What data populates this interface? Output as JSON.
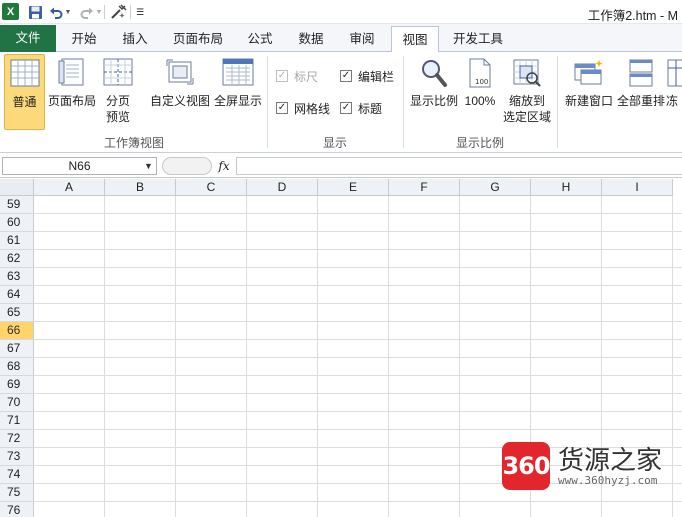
{
  "app": {
    "logo_letter": "X",
    "document_title": "工作簿2.htm - M"
  },
  "quick_access": {
    "save_icon": "save-icon",
    "undo_icon": "undo-icon",
    "redo_icon": "redo-icon",
    "tool_icon": "tools-icon",
    "customize_icon": "customize-icon"
  },
  "tabs": [
    {
      "label": "文件"
    },
    {
      "label": "开始"
    },
    {
      "label": "插入"
    },
    {
      "label": "页面布局"
    },
    {
      "label": "公式"
    },
    {
      "label": "数据"
    },
    {
      "label": "审阅"
    },
    {
      "label": "视图"
    },
    {
      "label": "开发工具"
    }
  ],
  "active_tab": "视图",
  "ribbon": {
    "workbook_views": {
      "label": "工作簿视图",
      "normal": "普通",
      "page_layout": "页面布局",
      "page_break_line1": "分页",
      "page_break_line2": "预览",
      "custom_views": "自定义视图",
      "full_screen": "全屏显示"
    },
    "show": {
      "label": "显示",
      "ruler": "标尺",
      "formula_bar": "编辑栏",
      "gridlines": "网格线",
      "headings": "标题"
    },
    "zoom": {
      "label": "显示比例",
      "zoom_btn": "显示比例",
      "hundred": "100%",
      "zoom_sel_line1": "缩放到",
      "zoom_sel_line2": "选定区域"
    },
    "window": {
      "new_window": "新建窗口",
      "arrange_all": "全部重排",
      "freeze_partial": "冻"
    }
  },
  "formula_bar": {
    "name_box": "N66",
    "fx": "fx",
    "formula": ""
  },
  "columns": [
    "A",
    "B",
    "C",
    "D",
    "E",
    "F",
    "G",
    "H",
    "I"
  ],
  "rows": [
    "59",
    "60",
    "61",
    "62",
    "63",
    "64",
    "65",
    "66",
    "67",
    "68",
    "69",
    "70",
    "71",
    "72",
    "73",
    "74",
    "75",
    "76"
  ],
  "selected_row": "66",
  "watermark": {
    "logo_text": "360",
    "title": "货源之家",
    "url": "www.360hyzj.com"
  },
  "colors": {
    "file_tab": "#217346",
    "selected": "#fcd97a",
    "row_highlight": "#ffd56b",
    "watermark_red": "#e3262c"
  }
}
